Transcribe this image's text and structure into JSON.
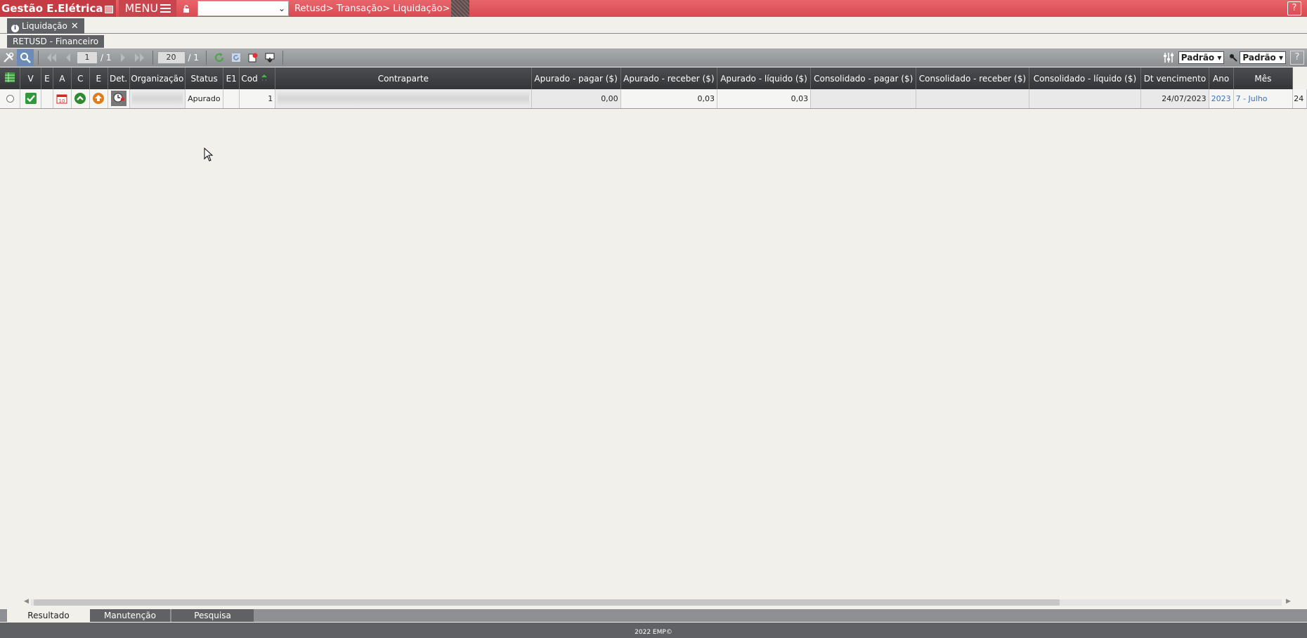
{
  "app": {
    "title": "Gestão E.Elétrica",
    "menu_label": "MENU",
    "breadcrumb": "Retusd> Transação> Liquidação>",
    "help_label": "?"
  },
  "tabs": {
    "page_tab": "Liquidação",
    "page_tab_close": "✕",
    "section_tab": "RETUSD - Financeiro"
  },
  "toolbar": {
    "page_current": "1",
    "page_total": "/ 1",
    "per_page": "20",
    "per_page_total": "/ 1",
    "layout_select": "Padrão ▾",
    "filter_select": "Padrão ▾",
    "help_label": "?"
  },
  "grid": {
    "headers": {
      "v": "V",
      "e": "E",
      "a": "A",
      "c": "C",
      "e2": "E",
      "det": "Det.",
      "organizacao": "Organização",
      "status": "Status",
      "e1": "E1",
      "cod": "Cod",
      "contraparte": "Contraparte",
      "apurado_pagar": "Apurado - pagar ($)",
      "apurado_receber": "Apurado - receber ($)",
      "apurado_liquido": "Apurado - líquido ($)",
      "consolidado_pagar": "Consolidado - pagar ($)",
      "consolidado_receber": "Consolidado - receber ($)",
      "consolidado_liquido": "Consolidado - líquido ($)",
      "dt_vencimento": "Dt vencimento",
      "ano": "Ano",
      "mes": "Mês",
      "extra": "24"
    },
    "row": {
      "status": "Apurado",
      "cod": "1",
      "apurado_pagar": "0,00",
      "apurado_receber": "0,03",
      "apurado_liquido": "0,03",
      "dt_vencimento": "24/07/2023",
      "ano": "2023",
      "mes": "7 - Julho",
      "extra": "24"
    }
  },
  "bottom_tabs": [
    "Resultado",
    "Manutenção",
    "Pesquisa"
  ],
  "footer": "2022 EMP©",
  "colors": {
    "topbar": "#d94a52",
    "toolbar": "#8c8f92",
    "header": "#343538",
    "link": "#3a70c0"
  }
}
